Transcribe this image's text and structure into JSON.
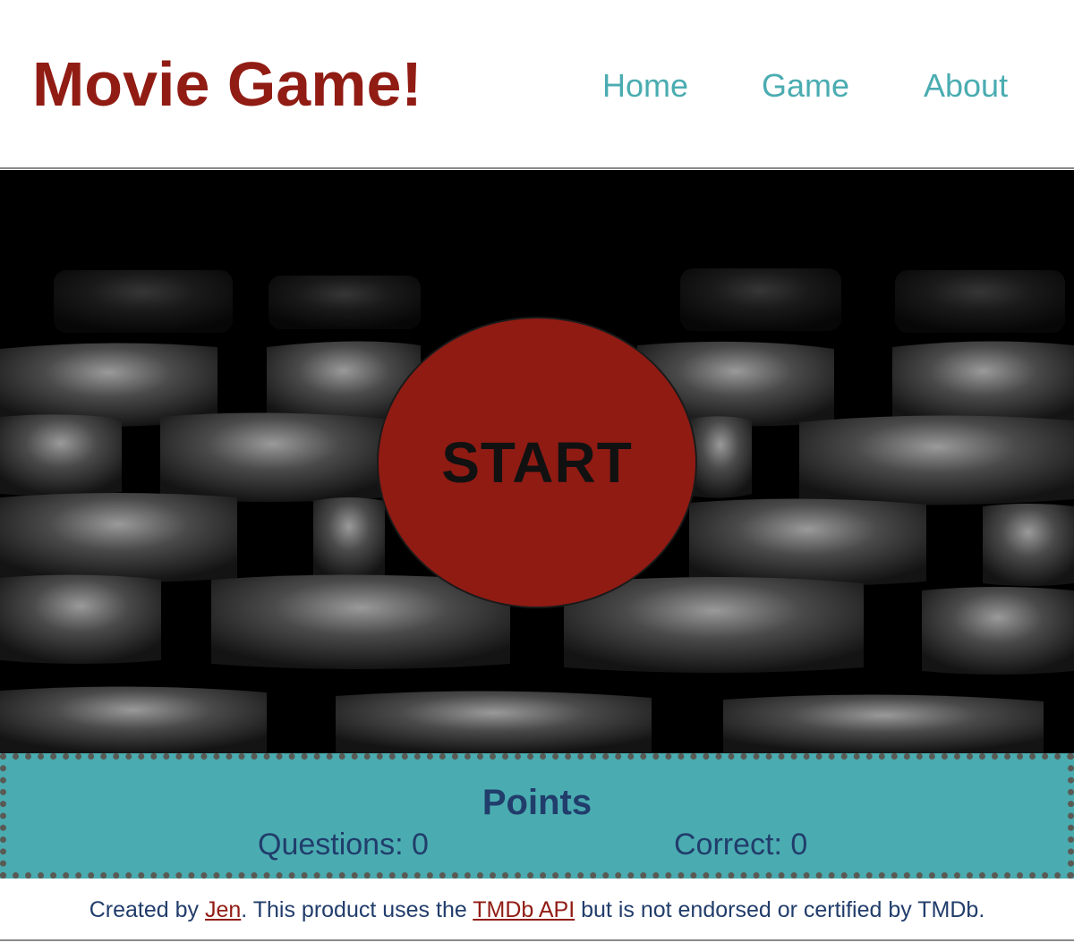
{
  "header": {
    "title": "Movie Game!",
    "nav": {
      "home": "Home",
      "game": "Game",
      "about": "About"
    }
  },
  "hero": {
    "start_label": "START"
  },
  "points": {
    "title": "Points",
    "questions_label": "Questions:",
    "questions_value": "0",
    "correct_label": "Correct:",
    "correct_value": "0"
  },
  "footer": {
    "prefix": "Created by ",
    "author_link": "Jen",
    "middle": ". This product uses the ",
    "api_link": "TMDb API",
    "suffix": " but is not endorsed or certified by TMDb."
  },
  "colors": {
    "brand_red": "#911c14",
    "start_red": "#901b13",
    "nav_teal": "#4aacb1",
    "panel_teal": "#4aacb1",
    "text_navy": "#213d6b"
  }
}
